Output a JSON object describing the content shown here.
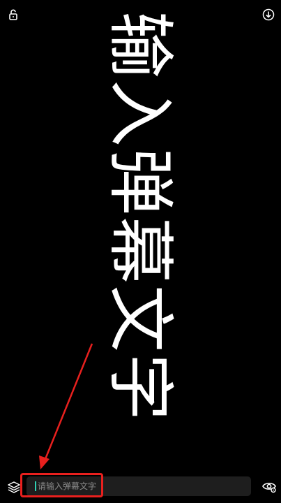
{
  "icons": {
    "top_left": "unlock-icon",
    "top_right": "download-icon",
    "bottom_left": "layers-icon",
    "bottom_right": "eye-settings-icon"
  },
  "danmaku": {
    "text": "输入弹幕文字"
  },
  "input": {
    "placeholder": "请输入弹幕文字",
    "value": ""
  },
  "colors": {
    "background": "#000000",
    "text": "#ffffff",
    "annotation_red": "#e8201e",
    "caret": "#2fd1b3",
    "input_bg": "#1e1e1e"
  }
}
